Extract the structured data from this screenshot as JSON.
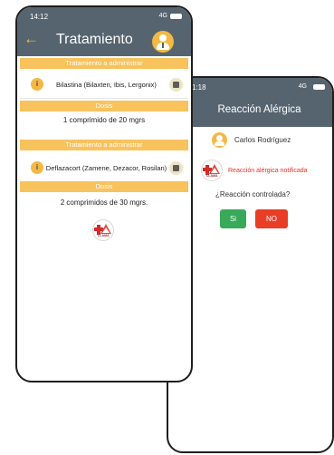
{
  "back_screen": {
    "time": "1:18",
    "signal": "4G",
    "title": "Reacción Alérgica",
    "patient_name": "Carlos Rodríguez",
    "alert_text": "Reacción alérgica notificada",
    "question": "¿Reacción controlada?",
    "yes_label": "Si",
    "no_label": "NO",
    "yes_color": "#38a958",
    "no_color": "#e83e25"
  },
  "front_screen": {
    "time": "14:12",
    "signal": "4G",
    "back_icon": "←",
    "title": "Tratamiento",
    "treatments": [
      {
        "header": "Tratamiento a administrar",
        "medication": "Bilastina (Bilaxten, Ibis, Lergonix)",
        "dose_header": "Dosis",
        "dose": "1 comprimido de 20 mgrs"
      },
      {
        "header": "Tratamiento a administrar",
        "medication": "Deflazacort (Zamene, Dezacor, Rosilan)",
        "dose_header": "Dosis",
        "dose": "2 comprimidos de 30 mgrs."
      }
    ],
    "info_symbol": "i",
    "logo_label": "LLAMA"
  },
  "colors": {
    "header": "#566470",
    "accent": "#f8c25c",
    "alert": "#e2332a"
  }
}
